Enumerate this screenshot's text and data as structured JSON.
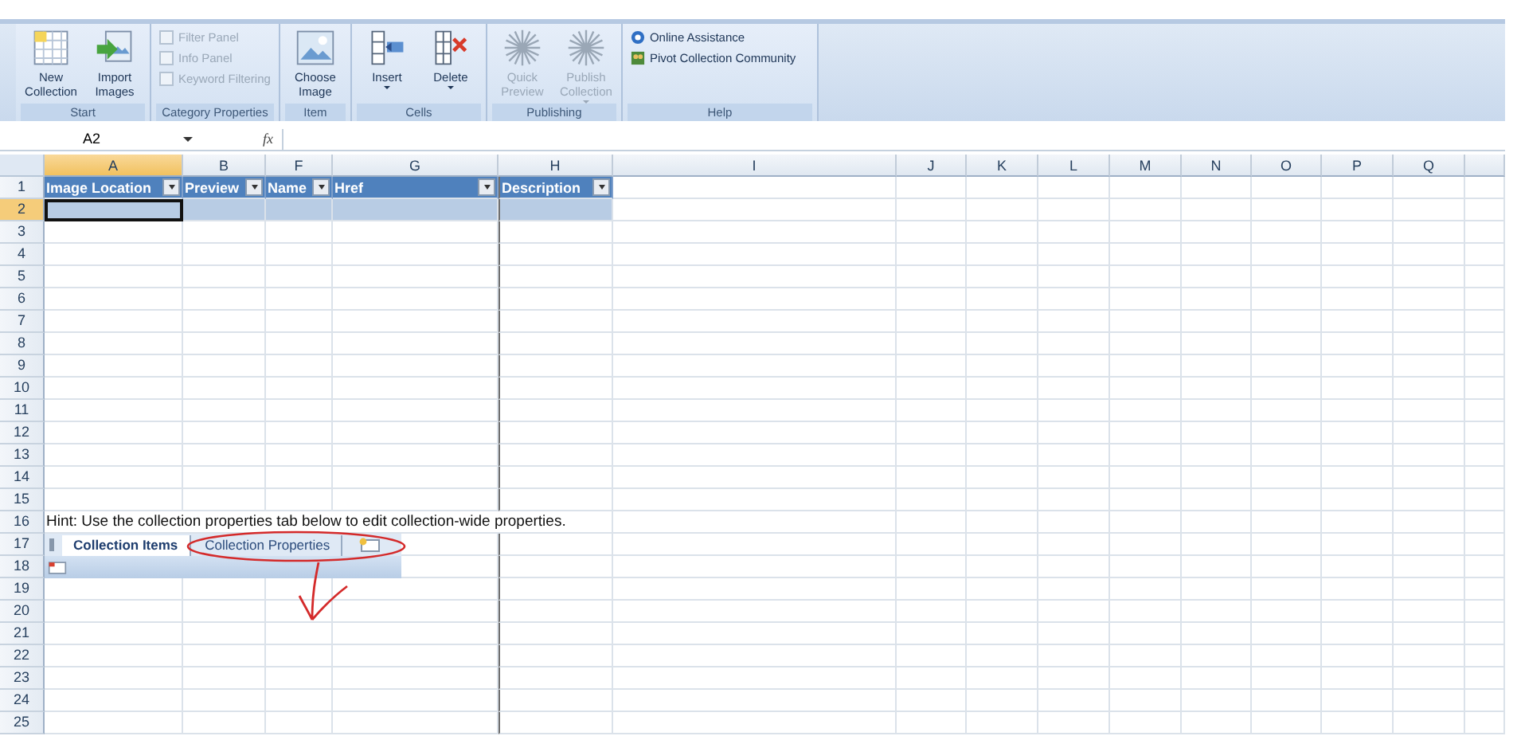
{
  "ribbon": {
    "groups": [
      {
        "label": "Start",
        "kind": "buttons",
        "items": [
          {
            "label": "New Collection",
            "disabled": false,
            "dropdown": false
          },
          {
            "label": "Import Images",
            "disabled": false,
            "dropdown": false
          }
        ]
      },
      {
        "label": "Category Properties",
        "kind": "checks",
        "items": [
          {
            "label": "Filter Panel",
            "checked": false,
            "disabled": true
          },
          {
            "label": "Info Panel",
            "checked": false,
            "disabled": true
          },
          {
            "label": "Keyword Filtering",
            "checked": false,
            "disabled": true
          }
        ]
      },
      {
        "label": "Item",
        "kind": "buttons",
        "items": [
          {
            "label": "Choose Image",
            "disabled": false,
            "dropdown": false
          }
        ]
      },
      {
        "label": "Cells",
        "kind": "buttons",
        "items": [
          {
            "label": "Insert",
            "disabled": false,
            "dropdown": true
          },
          {
            "label": "Delete",
            "disabled": false,
            "dropdown": true
          }
        ]
      },
      {
        "label": "Publishing",
        "kind": "buttons",
        "items": [
          {
            "label": "Quick Preview",
            "disabled": true,
            "dropdown": false
          },
          {
            "label": "Publish Collection",
            "disabled": true,
            "dropdown": true
          }
        ]
      },
      {
        "label": "Help",
        "kind": "links",
        "items": [
          {
            "label": "Online Assistance"
          },
          {
            "label": "Pivot Collection Community"
          }
        ]
      }
    ]
  },
  "formula_bar": {
    "name_box": "A2",
    "fx": "fx"
  },
  "grid": {
    "columns": [
      {
        "label": "A",
        "selected": true
      },
      {
        "label": "B",
        "selected": false
      },
      {
        "label": "F",
        "selected": false
      },
      {
        "label": "G",
        "selected": false
      },
      {
        "label": "H",
        "selected": false
      },
      {
        "label": "I",
        "selected": false
      },
      {
        "label": "J",
        "selected": false
      },
      {
        "label": "K",
        "selected": false
      },
      {
        "label": "L",
        "selected": false
      },
      {
        "label": "M",
        "selected": false
      },
      {
        "label": "N",
        "selected": false
      },
      {
        "label": "O",
        "selected": false
      },
      {
        "label": "P",
        "selected": false
      },
      {
        "label": "Q",
        "selected": false
      }
    ],
    "rows": [
      {
        "number": "1",
        "selected": false,
        "kind": "table-header",
        "cells": [
          "Image Location",
          "Preview",
          "Name",
          "Href",
          "Description"
        ]
      },
      {
        "number": "2",
        "selected": true,
        "kind": "table-row"
      },
      {
        "number": "3",
        "selected": false
      },
      {
        "number": "4",
        "selected": false
      },
      {
        "number": "5",
        "selected": false
      },
      {
        "number": "6",
        "selected": false
      },
      {
        "number": "7",
        "selected": false
      },
      {
        "number": "8",
        "selected": false
      },
      {
        "number": "9",
        "selected": false
      },
      {
        "number": "10",
        "selected": false
      },
      {
        "number": "11",
        "selected": false
      },
      {
        "number": "12",
        "selected": false
      },
      {
        "number": "13",
        "selected": false
      },
      {
        "number": "14",
        "selected": false
      },
      {
        "number": "15",
        "selected": false
      },
      {
        "number": "16",
        "selected": false,
        "kind": "text",
        "text": "Hint: Use the collection properties tab below to edit collection-wide properties."
      },
      {
        "number": "17",
        "selected": false,
        "kind": "sheet-tabs"
      },
      {
        "number": "18",
        "selected": false
      },
      {
        "number": "19",
        "selected": false
      },
      {
        "number": "20",
        "selected": false
      },
      {
        "number": "21",
        "selected": false
      },
      {
        "number": "22",
        "selected": false
      },
      {
        "number": "23",
        "selected": false
      },
      {
        "number": "24",
        "selected": false
      },
      {
        "number": "25",
        "selected": false
      }
    ]
  },
  "sheet_tabs": [
    {
      "label": "Collection Items",
      "selected": true
    },
    {
      "label": "Collection Properties",
      "selected": false
    }
  ]
}
